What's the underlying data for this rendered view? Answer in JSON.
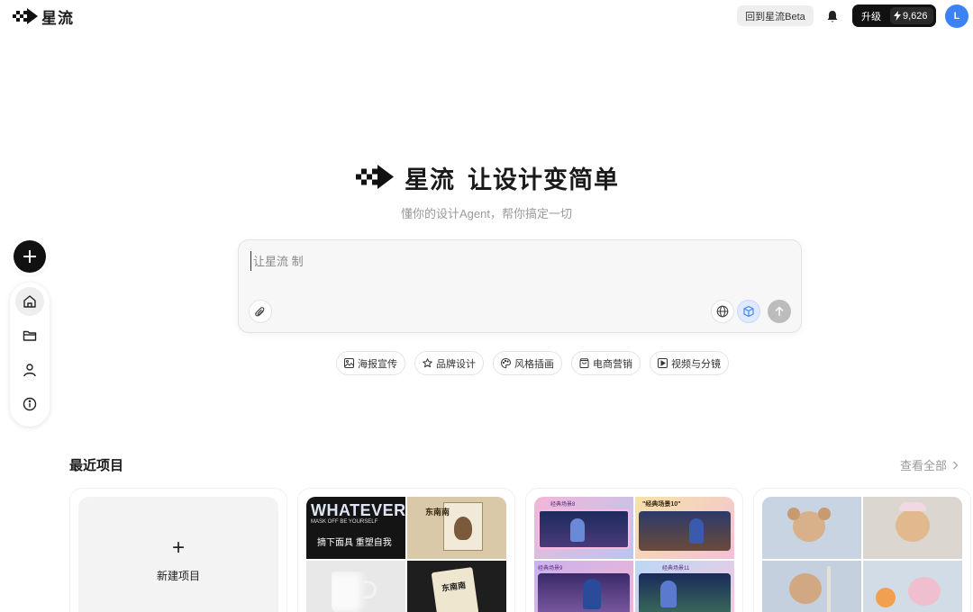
{
  "header": {
    "brand": "星流",
    "back_label": "回到星流Beta",
    "upgrade_label": "升级",
    "credits": "9,626",
    "avatar_initial": "L",
    "icons": [
      "pixel-logo-icon",
      "bell-icon",
      "bolt-icon"
    ]
  },
  "sidebar": {
    "create_icon": "plus-icon",
    "items": [
      {
        "name": "home",
        "icon": "home-icon",
        "active": true
      },
      {
        "name": "projects",
        "icon": "folder-icon",
        "active": false
      },
      {
        "name": "profile",
        "icon": "user-icon",
        "active": false
      },
      {
        "name": "about",
        "icon": "info-icon",
        "active": false
      }
    ]
  },
  "hero": {
    "brand": "星流",
    "slogan": "让设计变简单",
    "subtitle": "懂你的设计Agent，帮你搞定一切"
  },
  "prompt": {
    "placeholder": "让星流 制",
    "tools": [
      "paperclip-icon",
      "globe-icon",
      "cube-icon",
      "arrow-up-icon"
    ]
  },
  "quick_actions": [
    {
      "label": "海报宣传",
      "icon": "image-icon"
    },
    {
      "label": "品牌设计",
      "icon": "star-icon"
    },
    {
      "label": "风格插画",
      "icon": "palette-icon"
    },
    {
      "label": "电商营销",
      "icon": "shopping-bag-icon"
    },
    {
      "label": "视频与分镜",
      "icon": "play-icon"
    }
  ],
  "recent": {
    "title": "最近项目",
    "view_all": "查看全部",
    "new_project_label": "新建项目",
    "projects": [
      {
        "tiles": [
          {
            "heading": "WHATEVER",
            "tagline": "MASK OFF BE YOURSELF",
            "caption": "摘下面具 重塑自我"
          },
          {
            "heading": "东南南"
          },
          {
            "heading": ""
          },
          {
            "heading": "东南南"
          }
        ]
      },
      {
        "tiles": [
          {
            "heading": "经典场景8"
          },
          {
            "heading": "\"经典场景10\""
          },
          {
            "heading": "经典场景9"
          },
          {
            "heading": "经典场景11"
          }
        ]
      },
      {
        "tiles": [
          {
            "heading": ""
          },
          {
            "heading": ""
          },
          {
            "heading": ""
          },
          {
            "heading": ""
          }
        ]
      }
    ]
  },
  "colors": {
    "primary_dark": "#111111",
    "accent_blue": "#3b82f6",
    "muted_text": "#9a9a9a",
    "prompt_bg": "#f7f7f7"
  }
}
